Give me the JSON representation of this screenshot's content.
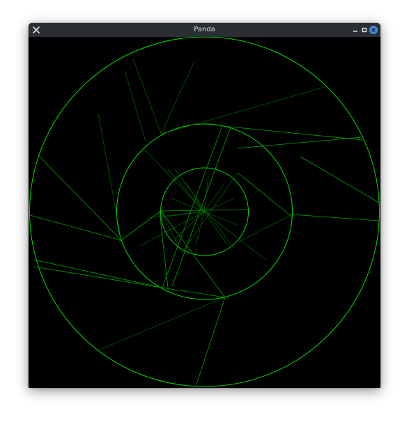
{
  "window": {
    "title": "Panda"
  },
  "titlebar": {
    "close_left_icon": "close-x-icon",
    "minimize_icon": "minimize-icon",
    "maximize_icon": "maximize-icon",
    "close_right_icon": "close-circle-icon"
  },
  "colors": {
    "titlebar_bg": "#2b2e33",
    "canvas_bg": "#000000",
    "stroke_green": "#00e000",
    "close_accent": "#3d8ee8"
  }
}
